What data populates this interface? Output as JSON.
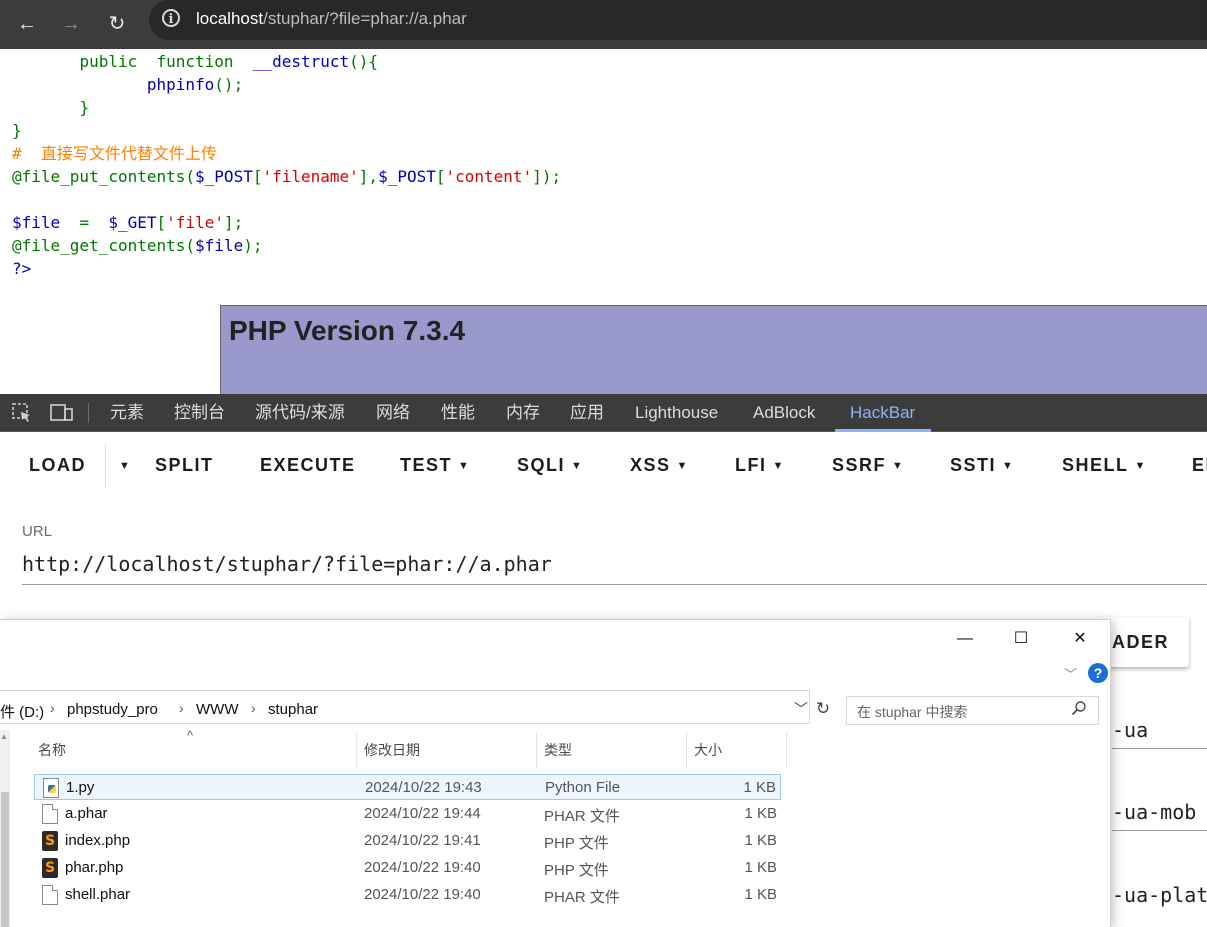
{
  "browser": {
    "nav": {
      "back_icon": "←",
      "forward_icon": "→",
      "reload_icon": "↻"
    },
    "url_host": "localhost",
    "url_rest": "/stuphar/?file=phar://a.phar"
  },
  "code": {
    "l1_kw1": "public",
    "l1_kw2": "function",
    "l1_fn": "__destruct",
    "l1_rest": "(){",
    "l2_fn": "phpinfo",
    "l2_rest": "();",
    "l3": "}",
    "l4": "}",
    "l5_comment": "#  直接写文件代替文件上传",
    "l6_a": "@file_put_contents(",
    "l6_v1": "$_POST",
    "l6_b": "[",
    "l6_s1": "'filename'",
    "l6_c": "],",
    "l6_v2": "$_POST",
    "l6_d": "[",
    "l6_s2": "'content'",
    "l6_e": "]);",
    "l8_v": "$file",
    "l8_eq": "  =  ",
    "l8_v2": "$_GET",
    "l8_b": "[",
    "l8_s": "'file'",
    "l8_e": "];",
    "l9_a": "@file_get_contents(",
    "l9_v": "$file",
    "l9_e": ");",
    "l10": "?>"
  },
  "phpinfo": {
    "title": "PHP Version 7.3.4"
  },
  "devtools": {
    "tabs": [
      "元素",
      "控制台",
      "源代码/来源",
      "网络",
      "性能",
      "内存",
      "应用",
      "Lighthouse",
      "AdBlock",
      "HackBar"
    ],
    "active_tab": "HackBar"
  },
  "hackbar": {
    "buttons": [
      "LOAD",
      "SPLIT",
      "EXECUTE",
      "TEST",
      "SQLI",
      "XSS",
      "LFI",
      "SSRF",
      "SSTI",
      "SHELL",
      "EI"
    ],
    "url_label": "URL",
    "url_value": "http://localhost/stuphar/?file=phar://a.phar",
    "header_button": "ADER",
    "ua_items": [
      "-ua",
      "-ua-mob",
      "-ua-plat"
    ]
  },
  "explorer": {
    "controls": {
      "minimize": "—",
      "maximize": "☐",
      "close": "✕"
    },
    "help": "?",
    "breadcrumb": [
      "件 (D:)",
      "phpstudy_pro",
      "WWW",
      "stuphar"
    ],
    "search_placeholder": "在 stuphar 中搜索",
    "columns": [
      "名称",
      "修改日期",
      "类型",
      "大小"
    ],
    "files": [
      {
        "name": "1.py",
        "date": "2024/10/22 19:43",
        "type": "Python File",
        "size": "1 KB",
        "icon": "python-file-icon",
        "selected": true
      },
      {
        "name": "a.phar",
        "date": "2024/10/22 19:44",
        "type": "PHAR 文件",
        "size": "1 KB",
        "icon": "document-icon",
        "selected": false
      },
      {
        "name": "index.php",
        "date": "2024/10/22 19:41",
        "type": "PHP 文件",
        "size": "1 KB",
        "icon": "php-file-icon",
        "selected": false
      },
      {
        "name": "phar.php",
        "date": "2024/10/22 19:40",
        "type": "PHP 文件",
        "size": "1 KB",
        "icon": "php-file-icon",
        "selected": false
      },
      {
        "name": "shell.phar",
        "date": "2024/10/22 19:40",
        "type": "PHAR 文件",
        "size": "1 KB",
        "icon": "document-icon",
        "selected": false
      }
    ]
  }
}
